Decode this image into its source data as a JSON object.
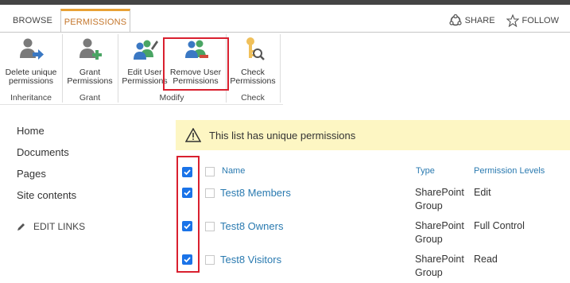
{
  "tabs": {
    "browse": "BROWSE",
    "permissions": "PERMISSIONS"
  },
  "actions": {
    "share": "SHARE",
    "follow": "FOLLOW"
  },
  "ribbon": {
    "delete_unique": "Delete unique permissions",
    "grant": "Grant Permissions",
    "edit_user": "Edit User Permissions",
    "remove_user": "Remove User Permissions",
    "check": "Check Permissions",
    "groups": {
      "inheritance": "Inheritance",
      "grant": "Grant",
      "modify": "Modify",
      "check": "Check"
    }
  },
  "nav": {
    "home": "Home",
    "documents": "Documents",
    "pages": "Pages",
    "site_contents": "Site contents",
    "edit_links": "EDIT LINKS"
  },
  "notice": "This list has unique permissions",
  "table": {
    "headers": {
      "name": "Name",
      "type": "Type",
      "levels": "Permission Levels"
    },
    "rows": [
      {
        "name": "Test8 Members",
        "type1": "SharePoint",
        "type2": "Group",
        "level": "Edit"
      },
      {
        "name": "Test8 Owners",
        "type1": "SharePoint",
        "type2": "Group",
        "level": "Full Control"
      },
      {
        "name": "Test8 Visitors",
        "type1": "SharePoint",
        "type2": "Group",
        "level": "Read"
      }
    ]
  },
  "colors": {
    "accent_orange": "#e8a135",
    "link_blue": "#2a7ab0",
    "checkbox_blue": "#1a73e8",
    "highlight_red": "#d9202f",
    "notice_yellow": "#fdf6c3"
  }
}
